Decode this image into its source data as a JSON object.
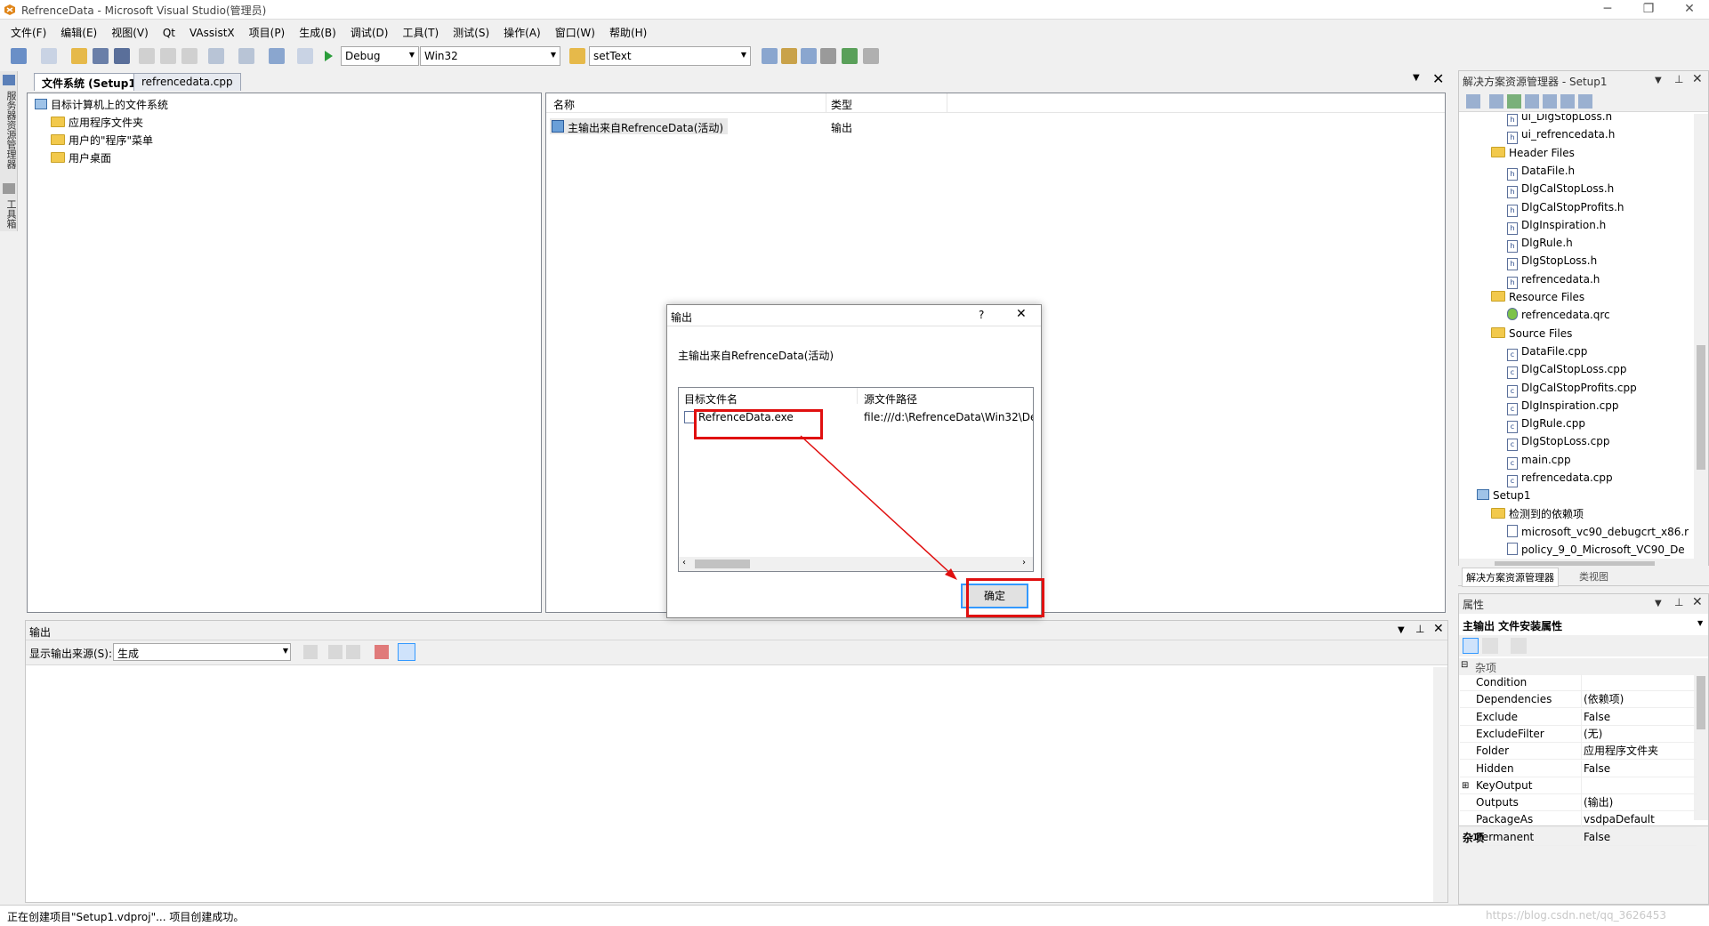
{
  "window": {
    "title": "RefrenceData - Microsoft Visual Studio(管理员)",
    "minimize": "─",
    "restore": "❐",
    "close": "✕"
  },
  "menu": [
    "文件(F)",
    "编辑(E)",
    "视图(V)",
    "Qt",
    "VAssistX",
    "项目(P)",
    "生成(B)",
    "调试(D)",
    "工具(T)",
    "测试(S)",
    "操作(A)",
    "窗口(W)",
    "帮助(H)"
  ],
  "toolbar": {
    "config": "Debug",
    "platform": "Win32",
    "find": "setText"
  },
  "left_tabs": [
    "服务器资源管理器",
    "工具箱"
  ],
  "doc_tabs": [
    {
      "label": "文件系统 (Setup1)",
      "active": true
    },
    {
      "label": "refrencedata.cpp",
      "active": false
    }
  ],
  "fs_tree": {
    "root": "目标计算机上的文件系统",
    "items": [
      "应用程序文件夹",
      "用户的\"程序\"菜单",
      "用户桌面"
    ]
  },
  "fs_list": {
    "columns": [
      "名称",
      "类型"
    ],
    "rows": [
      {
        "name": "主输出来自RefrenceData(活动)",
        "type": "输出"
      }
    ]
  },
  "dialog": {
    "title": "输出",
    "help": "?",
    "close": "✕",
    "subtitle": "主输出来自RefrenceData(活动)",
    "columns": [
      "目标文件名",
      "源文件路径"
    ],
    "rows": [
      {
        "target": "RefrenceData.exe",
        "source": "file:///d:\\RefrenceData\\Win32\\De"
      }
    ],
    "ok": "确定"
  },
  "output_panel": {
    "title": "输出",
    "source_label": "显示输出来源(S):",
    "source_value": "生成"
  },
  "solution_explorer": {
    "title": "解决方案资源管理器 - Setup1",
    "items": [
      {
        "label": "ui_DlgStopLoss.h",
        "type": "h"
      },
      {
        "label": "ui_refrencedata.h",
        "type": "h"
      },
      {
        "label": "Header Files",
        "type": "folder"
      },
      {
        "label": "DataFile.h",
        "type": "h"
      },
      {
        "label": "DlgCalStopLoss.h",
        "type": "h"
      },
      {
        "label": "DlgCalStopProfits.h",
        "type": "h"
      },
      {
        "label": "DlgInspiration.h",
        "type": "h"
      },
      {
        "label": "DlgRule.h",
        "type": "h"
      },
      {
        "label": "DlgStopLoss.h",
        "type": "h"
      },
      {
        "label": "refrencedata.h",
        "type": "h"
      },
      {
        "label": "Resource Files",
        "type": "folder"
      },
      {
        "label": "refrencedata.qrc",
        "type": "qrc"
      },
      {
        "label": "Source Files",
        "type": "folder"
      },
      {
        "label": "DataFile.cpp",
        "type": "cpp"
      },
      {
        "label": "DlgCalStopLoss.cpp",
        "type": "cpp"
      },
      {
        "label": "DlgCalStopProfits.cpp",
        "type": "cpp"
      },
      {
        "label": "DlgInspiration.cpp",
        "type": "cpp"
      },
      {
        "label": "DlgRule.cpp",
        "type": "cpp"
      },
      {
        "label": "DlgStopLoss.cpp",
        "type": "cpp"
      },
      {
        "label": "main.cpp",
        "type": "cpp"
      },
      {
        "label": "refrencedata.cpp",
        "type": "cpp"
      },
      {
        "label": "Setup1",
        "type": "setup"
      },
      {
        "label": "检测到的依赖项",
        "type": "folder"
      },
      {
        "label": "microsoft_vc90_debugcrt_x86.r",
        "type": "file"
      },
      {
        "label": "policy_9_0_Microsoft_VC90_De",
        "type": "file"
      }
    ],
    "bottom_tabs": [
      "解决方案资源管理器",
      "类视图"
    ]
  },
  "properties": {
    "title": "属性",
    "object": "主输出 文件安装属性",
    "category": "杂项",
    "rows": [
      {
        "name": "Condition",
        "value": ""
      },
      {
        "name": "Dependencies",
        "value": "(依赖项)"
      },
      {
        "name": "Exclude",
        "value": "False"
      },
      {
        "name": "ExcludeFilter",
        "value": "(无)"
      },
      {
        "name": "Folder",
        "value": "应用程序文件夹"
      },
      {
        "name": "Hidden",
        "value": "False"
      },
      {
        "name": "KeyOutput",
        "value": ""
      },
      {
        "name": "Outputs",
        "value": "(输出)"
      },
      {
        "name": "PackageAs",
        "value": "vsdpaDefault"
      },
      {
        "name": "Permanent",
        "value": "False"
      }
    ],
    "description": "杂项"
  },
  "status": {
    "text": "正在创建项目\"Setup1.vdproj\"... 项目创建成功。",
    "watermark": "https://blog.csdn.net/qq_3626453"
  },
  "colors": {
    "accent": "#3399ff",
    "highlight": "#e01010"
  }
}
